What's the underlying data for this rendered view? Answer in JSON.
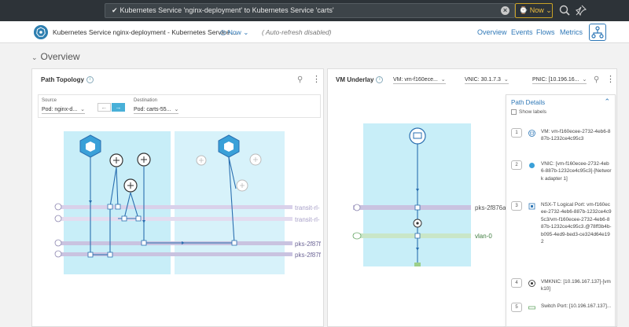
{
  "search": {
    "query": "Kubernetes Service 'nginx-deployment' to Kubernetes Service 'carts'",
    "time_button": "Now"
  },
  "header": {
    "title": "Kubernetes Service nginx-deployment - Kubernetes Service ...",
    "time": "Now",
    "auto_refresh": "( Auto-refresh disabled)",
    "nav": [
      "Overview",
      "Events",
      "Flows",
      "Metrics"
    ]
  },
  "section": {
    "title": "Overview"
  },
  "path_topology": {
    "title": "Path Topology",
    "source_label": "Source",
    "source_value": "Pod: nginx-d...",
    "destination_label": "Destination",
    "destination_value": "Pod: carts-55...",
    "direction_left": "←",
    "direction_right": "→",
    "row_labels": [
      "transit-rl-",
      "transit-rl-",
      "pks-2f87f",
      "pks-2f87f"
    ]
  },
  "vm_underlay": {
    "title": "VM Underlay",
    "vm_select": "VM: vm-f160ece...",
    "vnic_select": "VNIC: 30.1.7.3",
    "pnic_select": "PNIC: [10.196.16...",
    "row_labels": [
      "pks-2f876a",
      "vlan-0"
    ]
  },
  "path_details": {
    "title": "Path Details",
    "show_labels": "Show labels",
    "items": [
      {
        "num": "1",
        "icon": "vm-icon",
        "text": "VM: vm-f160ecee-2732-4eb6-887b-1232ce4c95c3"
      },
      {
        "num": "2",
        "icon": "vnic-icon",
        "text": "VNIC: [vm-f160ecee-2732-4eb6-887b-1232ce4c95c3]-[Network adapter 1]"
      },
      {
        "num": "3",
        "icon": "logical-port-icon",
        "text": "NSX-T Logical Port: vm-f160ecee-2732-4eb6-887b-1232ce4c95c3/vm-f160ecee-2732-4eb6-887b-1232ce4c95c3.@78ff3b4b-b095-4ed9-bed3-ce324d64e192"
      },
      {
        "num": "4",
        "icon": "vmknic-icon",
        "text": "VMKNIC: [10.196.167.137]-[vmk10]"
      },
      {
        "num": "5",
        "icon": "switch-port-icon",
        "text": "Switch Port: [10.196.167.137]..."
      }
    ]
  },
  "colors": {
    "topbar": "#2d3338",
    "accent": "#2f78b7",
    "highlight_zone": "#c8eef8",
    "lane_purple": "#d9d1ea",
    "lane_green": "#c9e6c8",
    "flow_line": "#2a6fb0"
  }
}
